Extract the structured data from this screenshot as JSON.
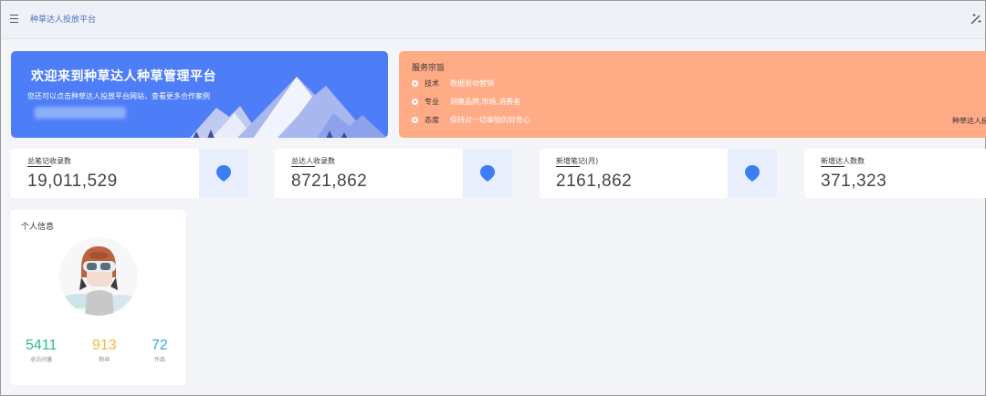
{
  "header": {
    "title": "种草达人投放平台",
    "menu_icon": "hamburger-icon",
    "tool_icon": "magic-wand-icon"
  },
  "welcome": {
    "title": "欢迎来到种草达人种草管理平台",
    "subtitle": "您还可以点击种草达人投放平台网站，查看更多合作案例"
  },
  "service": {
    "title": "服务宗旨",
    "rows": [
      {
        "key": "技术",
        "value": "数据驱动营销"
      },
      {
        "key": "专业",
        "value": "洞察品牌,市场,消费者"
      },
      {
        "key": "态度",
        "value": "保持对一切事物的好奇心"
      }
    ],
    "right_text": "种草达人投"
  },
  "stats": [
    {
      "label": "总笔记收录数",
      "value": "19,011,529"
    },
    {
      "label": "总达人收录数",
      "value": "8721,862"
    },
    {
      "label": "新增笔记(月)",
      "value": "2161,862"
    },
    {
      "label": "新增达人数数",
      "value": "371,323"
    }
  ],
  "profile": {
    "title": "个人信息",
    "metrics": [
      {
        "value": "5411",
        "label": "总访问量",
        "color": "#2bbf8e"
      },
      {
        "value": "913",
        "label": "粉丝",
        "color": "#f5b935"
      },
      {
        "value": "72",
        "label": "作品",
        "color": "#3aa3e8"
      }
    ]
  },
  "colors": {
    "primary": "#4d7df7",
    "service_bg": "#ffab86",
    "icon_bg": "#e8eefc"
  }
}
